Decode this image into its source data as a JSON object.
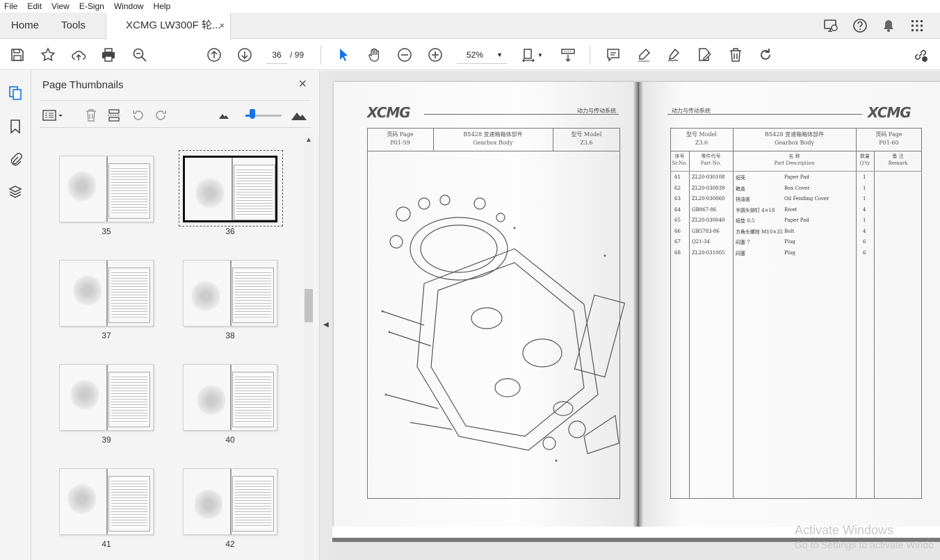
{
  "menu": [
    "File",
    "Edit",
    "View",
    "E-Sign",
    "Window",
    "Help"
  ],
  "tabs": {
    "home": "Home",
    "tools": "Tools",
    "doc": "XCMG LW300F 轮...",
    "close": "×"
  },
  "toolbar": {
    "page_current": "36",
    "page_total": "/ 99",
    "zoom": "52%"
  },
  "panel": {
    "title": "Page Thumbnails",
    "close": "×"
  },
  "thumbnails": [
    "35",
    "36",
    "37",
    "38",
    "39",
    "40",
    "41",
    "42"
  ],
  "document": {
    "logo": "XCMG",
    "header_cn": "动力与传动系统",
    "left": {
      "page_label": "页码 Page",
      "page_no": "P01-59",
      "part_cn": "BS428  变速箱箱体部件",
      "part_en": "Gearbox Body",
      "model_label": "型号 Model",
      "model_no": "Z3.6"
    },
    "right": {
      "model_label": "型号 Model",
      "model_no": "Z3.6",
      "part_cn": "BS428  变速箱箱体部件",
      "part_en": "Gearbox Body",
      "page_label": "页码 Page",
      "page_no": "P01-60",
      "col_no_cn": "序号",
      "col_no_en": "Sr.No.",
      "col_part_cn": "零件代号",
      "col_part_en": "Part No.",
      "col_desc_cn": "名     称",
      "col_desc_en": "Part Description",
      "col_qty_cn": "数量",
      "col_qty_en": "Q'ty",
      "col_rem_cn": "备  注",
      "col_rem_en": "Remark",
      "rows": [
        {
          "no": "61",
          "part": "ZL20-030108",
          "cn": "纸壳",
          "en": "Paper Pad",
          "qty": "1"
        },
        {
          "no": "62",
          "part": "ZL20-030039",
          "cn": "箱盖",
          "en": "Box Cover",
          "qty": "1"
        },
        {
          "no": "63",
          "part": "ZL20-030060",
          "cn": "挡油盖",
          "en": "Oil Fending Cover",
          "qty": "1"
        },
        {
          "no": "64",
          "part": "GB867-86",
          "cn": "半圆头铆钉 4×18",
          "en": "Rivet",
          "qty": "4"
        },
        {
          "no": "65",
          "part": "ZL20-030040",
          "cn": "纸垫 0.5",
          "en": "Paper Pad",
          "qty": "1"
        },
        {
          "no": "66",
          "part": "GB5783-86",
          "cn": "方角头螺栓 M10×35",
          "en": "Bolt",
          "qty": "4"
        },
        {
          "no": "67",
          "part": "Q21-34",
          "cn": "闷塞 7",
          "en": "Plug",
          "qty": "6"
        },
        {
          "no": "68",
          "part": "ZL20-031005",
          "cn": "闷塞",
          "en": "Plug",
          "qty": "6"
        }
      ]
    }
  },
  "watermark": {
    "line1": "Activate Windows",
    "line2": "Go to Settings to activate Windo"
  }
}
